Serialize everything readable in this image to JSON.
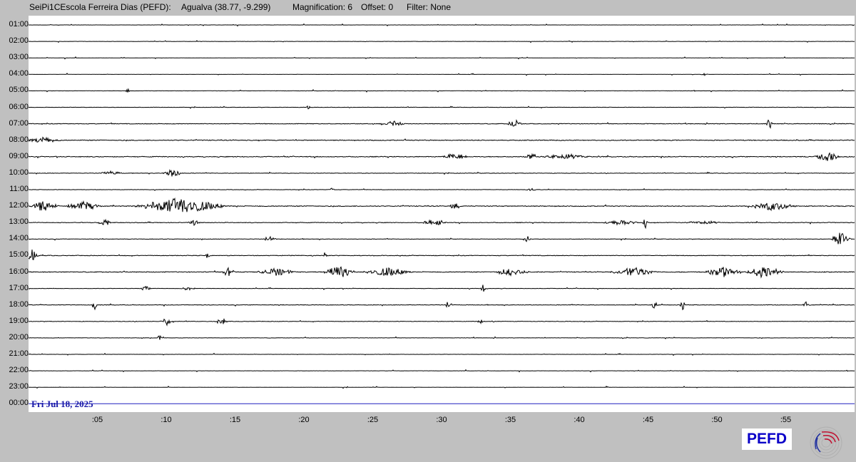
{
  "header": {
    "station": "SeiPi1CEscola Ferreira Dias (PEFD):",
    "location": "Agualva (38.77, -9.299)",
    "magnification": "Magnification: 6",
    "offset": "Offset: 0",
    "filter": "Filter: None"
  },
  "hour_labels": [
    "01:00",
    "02:00",
    "03:00",
    "04:00",
    "05:00",
    "06:00",
    "07:00",
    "08:00",
    "09:00",
    "10:00",
    "11:00",
    "12:00",
    "13:00",
    "14:00",
    "15:00",
    "16:00",
    "17:00",
    "18:00",
    "19:00",
    "20:00",
    "21:00",
    "22:00",
    "23:00",
    "00:00"
  ],
  "minute_labels": [
    ":05",
    ":10",
    ":15",
    ":20",
    ":25",
    ":30",
    ":35",
    ":40",
    ":45",
    ":50",
    ":55"
  ],
  "date_label": "Fri Jul 18, 2025",
  "logo_text": "PEFD",
  "icons": {
    "logo_mark": "fingerprint-logo-icon"
  },
  "colors": {
    "background": "#c0c0c0",
    "plot": "#ffffff",
    "trace": "#000000",
    "date_line": "#2020c0",
    "logo": "#0a00c8"
  },
  "traces": [
    {
      "hour": "01:00",
      "activity": 0.15,
      "bursts": []
    },
    {
      "hour": "02:00",
      "activity": 0.15,
      "bursts": []
    },
    {
      "hour": "03:00",
      "activity": 0.15,
      "bursts": []
    },
    {
      "hour": "04:00",
      "activity": 0.15,
      "bursts": [
        {
          "minute": 49,
          "amp": 2,
          "width": 0.2
        }
      ]
    },
    {
      "hour": "05:00",
      "activity": 0.2,
      "bursts": [
        {
          "minute": 7.2,
          "amp": 3,
          "width": 0.2
        }
      ]
    },
    {
      "hour": "06:00",
      "activity": 0.2,
      "bursts": [
        {
          "minute": 20.3,
          "amp": 3,
          "width": 0.2
        }
      ]
    },
    {
      "hour": "07:00",
      "activity": 0.4,
      "bursts": [
        {
          "minute": 26.5,
          "amp": 4,
          "width": 1
        },
        {
          "minute": 35.3,
          "amp": 6,
          "width": 0.6
        },
        {
          "minute": 53.8,
          "amp": 8,
          "width": 0.3
        }
      ]
    },
    {
      "hour": "08:00",
      "activity": 0.5,
      "bursts": [
        {
          "minute": 1,
          "amp": 4,
          "width": 1.5
        }
      ]
    },
    {
      "hour": "09:00",
      "activity": 0.5,
      "bursts": [
        {
          "minute": 31,
          "amp": 5,
          "width": 1
        },
        {
          "minute": 36.5,
          "amp": 8,
          "width": 0.5
        },
        {
          "minute": 39,
          "amp": 4,
          "width": 2
        },
        {
          "minute": 58,
          "amp": 6,
          "width": 1.2
        }
      ]
    },
    {
      "hour": "10:00",
      "activity": 0.3,
      "bursts": [
        {
          "minute": 6,
          "amp": 3,
          "width": 1
        },
        {
          "minute": 10.5,
          "amp": 6,
          "width": 0.8
        }
      ]
    },
    {
      "hour": "11:00",
      "activity": 0.2,
      "bursts": [
        {
          "minute": 22,
          "amp": 3,
          "width": 0.3
        },
        {
          "minute": 36.5,
          "amp": 3,
          "width": 0.4
        }
      ]
    },
    {
      "hour": "12:00",
      "activity": 0.5,
      "bursts": [
        {
          "minute": 1.2,
          "amp": 8,
          "width": 1.2
        },
        {
          "minute": 4,
          "amp": 6,
          "width": 1.5
        },
        {
          "minute": 11,
          "amp": 12,
          "width": 3.5
        },
        {
          "minute": 31,
          "amp": 5,
          "width": 0.5
        },
        {
          "minute": 54,
          "amp": 6,
          "width": 2
        }
      ]
    },
    {
      "hour": "13:00",
      "activity": 0.4,
      "bursts": [
        {
          "minute": 5.5,
          "amp": 5,
          "width": 0.6
        },
        {
          "minute": 12,
          "amp": 4,
          "width": 0.5
        },
        {
          "minute": 29.5,
          "amp": 5,
          "width": 1
        },
        {
          "minute": 43,
          "amp": 4,
          "width": 1.5
        },
        {
          "minute": 44.8,
          "amp": 10,
          "width": 0.2
        },
        {
          "minute": 49,
          "amp": 3,
          "width": 1.5
        }
      ]
    },
    {
      "hour": "14:00",
      "activity": 0.3,
      "bursts": [
        {
          "minute": 17.5,
          "amp": 4,
          "width": 0.6
        },
        {
          "minute": 36.2,
          "amp": 7,
          "width": 0.3
        },
        {
          "minute": 59,
          "amp": 10,
          "width": 0.8
        }
      ]
    },
    {
      "hour": "15:00",
      "activity": 0.4,
      "bursts": [
        {
          "minute": 0.3,
          "amp": 9,
          "width": 0.5
        },
        {
          "minute": 21.5,
          "amp": 8,
          "width": 0.2
        },
        {
          "minute": 13,
          "amp": 5,
          "width": 0.2
        }
      ]
    },
    {
      "hour": "16:00",
      "activity": 0.5,
      "bursts": [
        {
          "minute": 14.5,
          "amp": 7,
          "width": 0.5
        },
        {
          "minute": 18,
          "amp": 6,
          "width": 1.5
        },
        {
          "minute": 22.5,
          "amp": 10,
          "width": 1.2
        },
        {
          "minute": 26,
          "amp": 6,
          "width": 2
        },
        {
          "minute": 35,
          "amp": 5,
          "width": 1.5
        },
        {
          "minute": 44,
          "amp": 7,
          "width": 1.8
        },
        {
          "minute": 50.5,
          "amp": 8,
          "width": 1.5
        },
        {
          "minute": 53.5,
          "amp": 9,
          "width": 1.5
        }
      ]
    },
    {
      "hour": "17:00",
      "activity": 0.25,
      "bursts": [
        {
          "minute": 8.5,
          "amp": 3,
          "width": 0.5
        },
        {
          "minute": 11.5,
          "amp": 3,
          "width": 0.5
        },
        {
          "minute": 33,
          "amp": 7,
          "width": 0.2
        }
      ]
    },
    {
      "hour": "18:00",
      "activity": 0.35,
      "bursts": [
        {
          "minute": 4.8,
          "amp": 12,
          "width": 0.2
        },
        {
          "minute": 30.5,
          "amp": 6,
          "width": 0.3
        },
        {
          "minute": 45.5,
          "amp": 7,
          "width": 0.3
        },
        {
          "minute": 47.5,
          "amp": 10,
          "width": 0.2
        },
        {
          "minute": 56.5,
          "amp": 5,
          "width": 0.3
        }
      ]
    },
    {
      "hour": "19:00",
      "activity": 0.3,
      "bursts": [
        {
          "minute": 10,
          "amp": 6,
          "width": 0.5
        },
        {
          "minute": 14,
          "amp": 6,
          "width": 0.5
        },
        {
          "minute": 32.8,
          "amp": 8,
          "width": 0.2
        }
      ]
    },
    {
      "hour": "20:00",
      "activity": 0.2,
      "bursts": [
        {
          "minute": 9.5,
          "amp": 5,
          "width": 0.2
        }
      ]
    },
    {
      "hour": "21:00",
      "activity": 0.15,
      "bursts": []
    },
    {
      "hour": "22:00",
      "activity": 0.15,
      "bursts": []
    },
    {
      "hour": "23:00",
      "activity": 0.15,
      "bursts": []
    },
    {
      "hour": "00:00",
      "activity": 0,
      "bursts": []
    }
  ]
}
